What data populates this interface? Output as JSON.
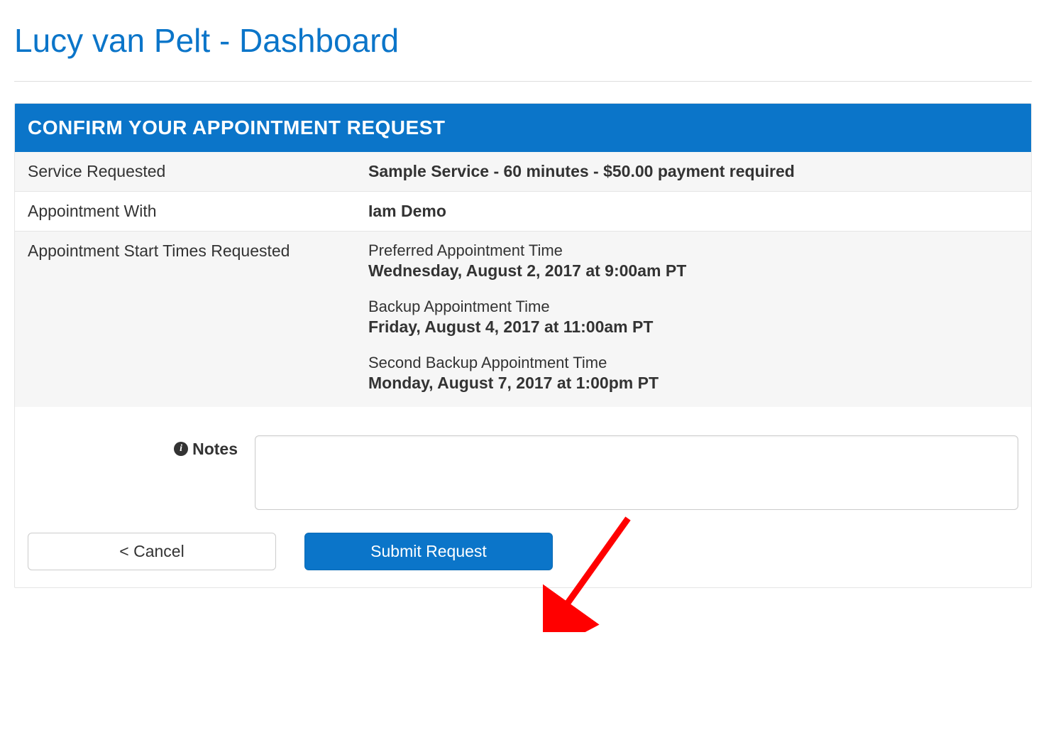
{
  "page": {
    "title": "Lucy van Pelt - Dashboard"
  },
  "panel": {
    "header": "CONFIRM YOUR APPOINTMENT REQUEST",
    "rows": {
      "service": {
        "label": "Service Requested",
        "value": "Sample Service - 60 minutes - $50.00 payment required"
      },
      "with": {
        "label": "Appointment With",
        "value": "Iam Demo"
      },
      "times": {
        "label": "Appointment Start Times Requested",
        "preferred": {
          "label": "Preferred Appointment Time",
          "value": "Wednesday, August 2, 2017 at 9:00am PT"
        },
        "backup1": {
          "label": "Backup Appointment Time",
          "value": "Friday, August 4, 2017 at 11:00am PT"
        },
        "backup2": {
          "label": "Second Backup Appointment Time",
          "value": "Monday, August 7, 2017 at 1:00pm PT"
        }
      }
    },
    "notes": {
      "label": "Notes",
      "value": ""
    },
    "buttons": {
      "cancel": "< Cancel",
      "submit": "Submit Request"
    }
  }
}
